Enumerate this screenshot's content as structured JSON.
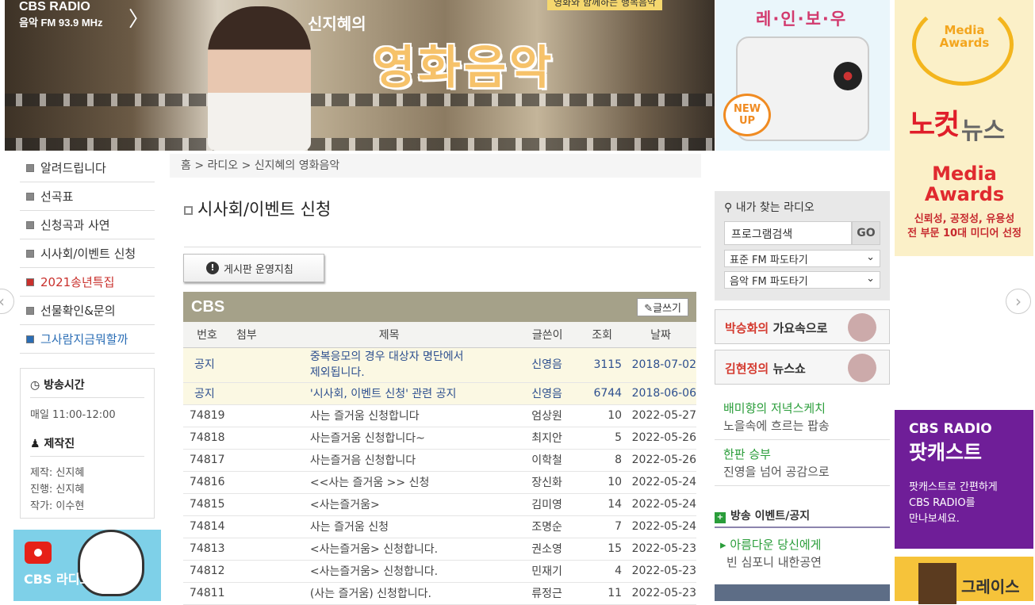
{
  "banner": {
    "station_name": "CBS RADIO",
    "station_freq": "음악 FM 93.9 MHz",
    "station_arrow": "〉",
    "show_prefix": "신지혜의",
    "show_title": "영화음악",
    "top_strip_text": "영화와 함께하는 행복음악"
  },
  "rainbow_ad": {
    "title": "레·인·보·우",
    "new_badge": "NEW UP"
  },
  "awards_ad": {
    "wreath_text": "Media Awards",
    "brand_1": "노컷",
    "brand_2": "뉴스",
    "big_text": "Media Awards",
    "sub_text_1": "신뢰성, 공정성, 유용성",
    "sub_text_2": "전 부문 10대 미디어 선정"
  },
  "left_nav": [
    {
      "label": "알려드립니다"
    },
    {
      "label": "선곡표"
    },
    {
      "label": "신청곡과 사연"
    },
    {
      "label": "시사회/이벤트 신청"
    },
    {
      "label": "2021송년특집"
    },
    {
      "label": "선물확인&문의"
    },
    {
      "label": "그사람지금뭐할까"
    }
  ],
  "info": {
    "time_title": "방송시간",
    "time_value": "매일 11:00-12:00",
    "staff_title": "제작진",
    "staff": [
      "제작: 신지혜",
      "진행: 신지혜",
      "작가: 이수현"
    ]
  },
  "pod_left": {
    "text": "CBS 라디오"
  },
  "breadcrumb": "홈 > 라디오 > 신지혜의 영화음악",
  "page_title": "시사회/이벤트 신청",
  "guide_button": "게시판 운영지침",
  "board": {
    "logo": "CBS",
    "write_button": "글쓰기",
    "columns": [
      "번호",
      "첨부",
      "제목",
      "글쓴이",
      "조회",
      "날짜"
    ],
    "notices": [
      {
        "num": "공지",
        "title_1": "중복응모의 경우 대상자 명단에서",
        "title_2": "제외됩니다.",
        "author": "신영음",
        "views": "3115",
        "date": "2018-07-02"
      },
      {
        "num": "공지",
        "title": "'시사회, 이벤트 신청' 관련 공지",
        "author": "신영음",
        "views": "6744",
        "date": "2018-06-06"
      }
    ],
    "rows": [
      {
        "num": "74819",
        "title": "사는 즐거움 신청합니다",
        "author": "엄상원",
        "views": "10",
        "date": "2022-05-27"
      },
      {
        "num": "74818",
        "title": "사는즐거움 신청합니다~",
        "author": "최지안",
        "views": "5",
        "date": "2022-05-26"
      },
      {
        "num": "74817",
        "title": "사는즐거음 신청합니다",
        "author": "이학철",
        "views": "8",
        "date": "2022-05-26"
      },
      {
        "num": "74816",
        "title": "<<사는 즐거움 >> 신청",
        "author": "장신화",
        "views": "10",
        "date": "2022-05-24"
      },
      {
        "num": "74815",
        "title": "<사는즐거움>",
        "author": "김미영",
        "views": "14",
        "date": "2022-05-24"
      },
      {
        "num": "74814",
        "title": "사는 즐거움 신청",
        "author": "조명순",
        "views": "7",
        "date": "2022-05-24"
      },
      {
        "num": "74813",
        "title": "<사는즐거움> 신청합니다.",
        "author": "권소영",
        "views": "15",
        "date": "2022-05-23"
      },
      {
        "num": "74812",
        "title": "<사는즐거움> 신청합니다.",
        "author": "민재기",
        "views": "4",
        "date": "2022-05-23"
      },
      {
        "num": "74811",
        "title": "(사는 즐거움) 신청합니다.",
        "author": "류정근",
        "views": "11",
        "date": "2022-05-23"
      }
    ]
  },
  "search": {
    "label": "내가 찾는 라디오",
    "input_value": "프로그램검색",
    "go": "GO",
    "select_1": "표준 FM 파도타기",
    "select_2": "음악 FM 파도타기"
  },
  "programs": [
    {
      "host": "박승화의",
      "name": "가요속으로"
    },
    {
      "host": "김현정의",
      "name": "뉴스쇼"
    }
  ],
  "recommend": [
    {
      "title": "배미향의 저녁스케치",
      "sub": "노을속에 흐르는 팝송"
    },
    {
      "title": "한판 승부",
      "sub": "진영을 넘어 공감으로"
    }
  ],
  "events": {
    "head": "방송 이벤트/공지",
    "title": "아름다운 당신에게",
    "sub": "빈 심포니 내한공연"
  },
  "podcast_ad": {
    "line1": "CBS RADIO",
    "line2": "팟캐스트",
    "line3": "팟캐스트로 간편하게",
    "line4": "CBS RADIO를",
    "line5": "만나보세요."
  },
  "grace_ad": "그레이스"
}
